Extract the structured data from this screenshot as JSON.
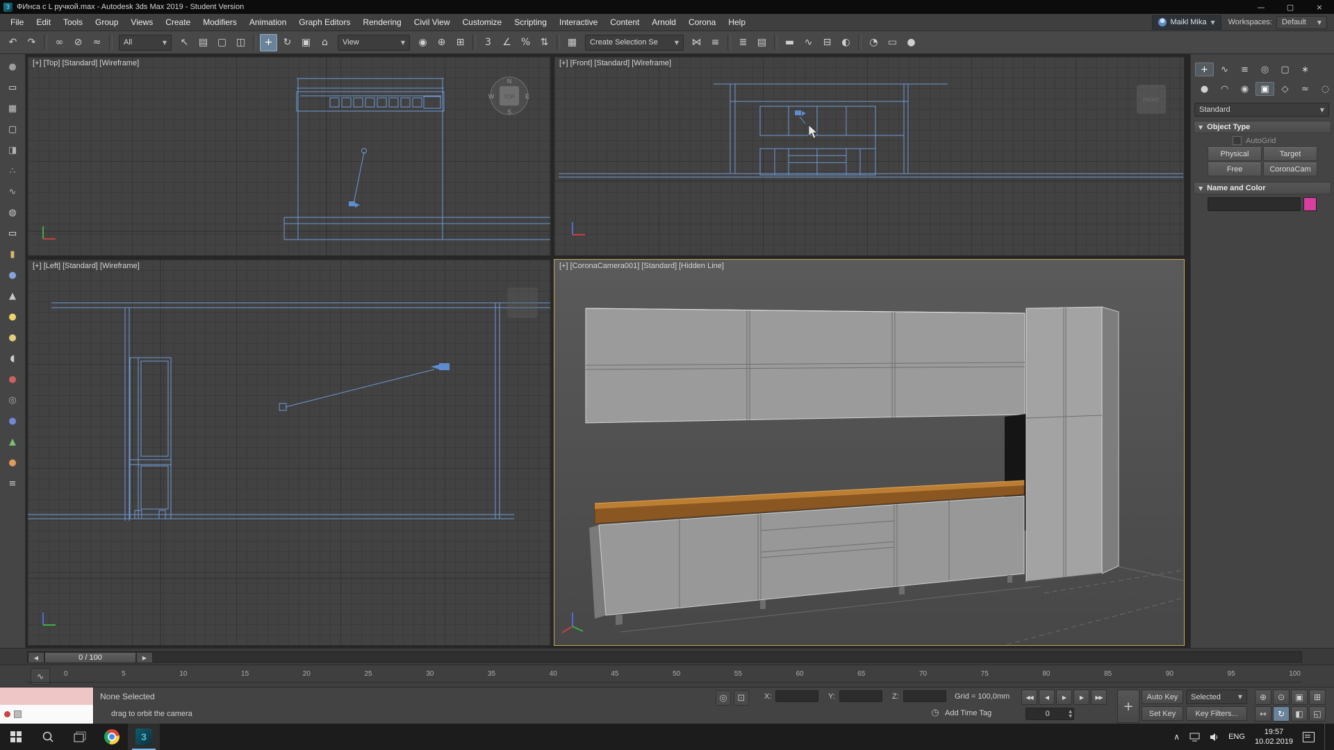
{
  "window": {
    "title": "ФИнса с L ручкой.max - Autodesk 3ds Max 2019 - Student Version",
    "controls": [
      {
        "name": "minimize-button",
        "glyph": "—"
      },
      {
        "name": "maximize-button",
        "glyph": "▢"
      },
      {
        "name": "close-button",
        "glyph": "×"
      }
    ]
  },
  "menu": {
    "items": [
      "File",
      "Edit",
      "Tools",
      "Group",
      "Views",
      "Create",
      "Modifiers",
      "Animation",
      "Graph Editors",
      "Rendering",
      "Civil View",
      "Customize",
      "Scripting",
      "Interactive",
      "Content",
      "Arnold",
      "Corona",
      "Help"
    ],
    "user": "Maikl Mika",
    "workspaces_label": "Workspaces:",
    "workspace": "Default"
  },
  "toolbar": {
    "filter_value": "All",
    "coord_value": "View",
    "selection_set_value": "Create Selection Se",
    "icons_a": [
      {
        "name": "undo-icon",
        "glyph": "↶"
      },
      {
        "name": "redo-icon",
        "glyph": "↷"
      },
      {
        "name": "toolbar-separator",
        "type": "sep"
      },
      {
        "name": "select-and-link-icon",
        "glyph": "∞"
      },
      {
        "name": "unlink-selection-icon",
        "glyph": "⊘"
      },
      {
        "name": "bind-to-space-warp-icon",
        "glyph": "≈"
      },
      {
        "name": "toolbar-separator",
        "type": "sep"
      }
    ],
    "icons_b": [
      {
        "name": "select-object-icon",
        "glyph": "↖"
      },
      {
        "name": "select-by-name-icon",
        "glyph": "▤"
      },
      {
        "name": "rectangular-selection-region-icon",
        "glyph": "▢"
      },
      {
        "name": "window-crossing-icon",
        "glyph": "◫"
      },
      {
        "name": "toolbar-separator",
        "type": "sep"
      },
      {
        "name": "select-and-move-icon",
        "glyph": "+",
        "active": true
      },
      {
        "name": "select-and-rotate-icon",
        "glyph": "↻"
      },
      {
        "name": "select-and-scale-icon",
        "glyph": "▣"
      },
      {
        "name": "select-and-place-icon",
        "glyph": "⌂"
      }
    ],
    "icons_c": [
      {
        "name": "use-pivot-point-center-icon",
        "glyph": "◉"
      },
      {
        "name": "select-and-manipulate-icon",
        "glyph": "⊕"
      },
      {
        "name": "keyboard-shortcut-override-icon",
        "glyph": "⊞"
      },
      {
        "name": "toolbar-separator",
        "type": "sep"
      },
      {
        "name": "snaps-toggle-3d-icon",
        "glyph": "3"
      },
      {
        "name": "angle-snap-toggle-icon",
        "glyph": "∠"
      },
      {
        "name": "percent-snap-toggle-icon",
        "glyph": "%"
      },
      {
        "name": "spinner-snap-toggle-icon",
        "glyph": "⇅"
      },
      {
        "name": "toolbar-separator",
        "type": "sep"
      },
      {
        "name": "edit-named-selection-sets-icon",
        "glyph": "▦"
      }
    ],
    "icons_d": [
      {
        "name": "mirror-icon",
        "glyph": "⋈"
      },
      {
        "name": "align-icon",
        "glyph": "≡"
      },
      {
        "name": "toolbar-separator",
        "type": "sep"
      },
      {
        "name": "toggle-scene-explorer-icon",
        "glyph": "≣"
      },
      {
        "name": "toggle-layer-explorer-icon",
        "glyph": "▤"
      },
      {
        "name": "toolbar-separator",
        "type": "sep"
      },
      {
        "name": "toggle-ribbon-icon",
        "glyph": "▬"
      },
      {
        "name": "curve-editor-icon",
        "glyph": "∿"
      },
      {
        "name": "schematic-view-icon",
        "glyph": "⊟"
      },
      {
        "name": "material-editor-icon",
        "glyph": "◐"
      },
      {
        "name": "toolbar-separator",
        "type": "sep"
      },
      {
        "name": "render-setup-icon",
        "glyph": "◔"
      },
      {
        "name": "rendered-frame-window-icon",
        "glyph": "▭"
      },
      {
        "name": "render-production-icon",
        "glyph": "●"
      }
    ]
  },
  "left_toolbar": {
    "items": [
      {
        "name": "sphere-gray-icon",
        "glyph": "●",
        "color": "#9c9c9c"
      },
      {
        "name": "plane-icon",
        "glyph": "▭",
        "color": "#e2e2e2"
      },
      {
        "name": "grid-icon",
        "glyph": "▦",
        "color": "#c4c4c4"
      },
      {
        "name": "box-icon",
        "glyph": "▢",
        "color": "#d6d6d6"
      },
      {
        "name": "panel-icon",
        "glyph": "◨",
        "color": "#b4b4b4"
      },
      {
        "name": "spray-icon",
        "glyph": "∴",
        "color": "#c0a8a8"
      },
      {
        "name": "wave-icon",
        "glyph": "∿",
        "color": "#b0b0c0"
      },
      {
        "name": "donut-icon",
        "glyph": "◍",
        "color": "#cccccc"
      },
      {
        "name": "plane-white-icon",
        "glyph": "▭",
        "color": "#f2f2f2"
      },
      {
        "name": "cylinder-icon",
        "glyph": "▮",
        "color": "#d6ba6e"
      },
      {
        "name": "sphere-blue-icon",
        "glyph": "●",
        "color": "#88a4dc"
      },
      {
        "name": "cone-icon",
        "glyph": "▲",
        "color": "#c9c9c9"
      },
      {
        "name": "sun-icon",
        "glyph": "●",
        "color": "#ecd36a"
      },
      {
        "name": "sphere-yellow-icon",
        "glyph": "●",
        "color": "#e3cd7c"
      },
      {
        "name": "teapot-icon",
        "glyph": "◖",
        "color": "#cfcfcf"
      },
      {
        "name": "sphere-red-icon",
        "glyph": "●",
        "color": "#d06060"
      },
      {
        "name": "wheel-icon",
        "glyph": "◎",
        "color": "#b0b0b0"
      },
      {
        "name": "sphere-blue2-icon",
        "glyph": "●",
        "color": "#6f88d6"
      },
      {
        "name": "cone-green-icon",
        "glyph": "▲",
        "color": "#7fbf6f"
      },
      {
        "name": "sphere-orange-icon",
        "glyph": "●",
        "color": "#e09a5a"
      },
      {
        "name": "menu-lines-icon",
        "glyph": "≡",
        "color": "#c8c8c8"
      }
    ]
  },
  "viewports": {
    "top_label": "[+] [Top] [Standard] [Wireframe]",
    "front_label": "[+] [Front] [Standard] [Wireframe]",
    "left_label": "[+] [Left] [Standard] [Wireframe]",
    "camera_label": "[+] [CoronaCamera001] [Standard] [Hidden Line]",
    "viewcube_top": "TOP",
    "viewcube_front": "FRONT"
  },
  "command_panel": {
    "tabs": [
      {
        "name": "create-tab-icon",
        "glyph": "+",
        "active": true
      },
      {
        "name": "modify-tab-icon",
        "glyph": "∿"
      },
      {
        "name": "hierarchy-tab-icon",
        "glyph": "≡"
      },
      {
        "name": "motion-tab-icon",
        "glyph": "◎"
      },
      {
        "name": "display-tab-icon",
        "glyph": "▢"
      },
      {
        "name": "utilities-tab-icon",
        "glyph": "∗"
      }
    ],
    "categories": [
      {
        "name": "geometry-category-icon",
        "glyph": "●"
      },
      {
        "name": "shapes-category-icon",
        "glyph": "◠"
      },
      {
        "name": "lights-category-icon",
        "glyph": "◉"
      },
      {
        "name": "cameras-category-icon",
        "glyph": "▣",
        "active": true
      },
      {
        "name": "helpers-category-icon",
        "glyph": "◇"
      },
      {
        "name": "space-warps-category-icon",
        "glyph": "≈"
      },
      {
        "name": "systems-category-icon",
        "glyph": "◌"
      }
    ],
    "object_dropdown": "Standard",
    "rollout_object_type": "Object Type",
    "autogrid": "AutoGrid",
    "buttons": [
      "Physical",
      "Target",
      "Free",
      "CoronaCam"
    ],
    "rollout_name_color": "Name and Color",
    "color_swatch": "#d93da0"
  },
  "timeline": {
    "slider": "0 / 100",
    "left_arrow": "◀",
    "right_arrow": "▶",
    "ticks": [
      "0",
      "5",
      "10",
      "15",
      "20",
      "25",
      "30",
      "35",
      "40",
      "45",
      "50",
      "55",
      "60",
      "65",
      "70",
      "75",
      "80",
      "85",
      "90",
      "95",
      "100"
    ]
  },
  "status": {
    "selection": "None Selected",
    "prompt": "drag to orbit the camera",
    "isolate_glyph": "◎",
    "lock_glyph": "⊡",
    "x": "X:",
    "y": "Y:",
    "z": "Z:",
    "grid": "Grid = 100,0mm",
    "add_time_tag": "Add Time Tag",
    "clock_glyph": "◷",
    "auto_key": "Auto Key",
    "set_key": "Set Key",
    "selected_filter": "Selected",
    "key_filters": "Key Filters...",
    "frame_spinner": "0",
    "bigkey_glyph": "+",
    "playback": [
      {
        "name": "go-to-start-button",
        "glyph": "◀◀"
      },
      {
        "name": "previous-frame-button",
        "glyph": "◀"
      },
      {
        "name": "play-button",
        "glyph": "▶"
      },
      {
        "name": "next-frame-button",
        "glyph": "▶"
      },
      {
        "name": "go-to-end-button",
        "glyph": "▶▶"
      }
    ],
    "nav": [
      {
        "name": "zoom-icon",
        "glyph": "⊕"
      },
      {
        "name": "zoom-all-icon",
        "glyph": "⊙"
      },
      {
        "name": "zoom-extents-icon",
        "glyph": "▣"
      },
      {
        "name": "zoom-extents-all-icon",
        "glyph": "⊞"
      },
      {
        "name": "pan-view-icon",
        "glyph": "↔"
      },
      {
        "name": "orbit-icon",
        "glyph": "↻",
        "active": true
      },
      {
        "name": "field-of-view-icon",
        "glyph": "◧"
      },
      {
        "name": "maximize-viewport-toggle-icon",
        "glyph": "◱"
      }
    ]
  },
  "taskbar": {
    "lang": "ENG",
    "time": "19:57",
    "date": "10.02.2019",
    "tray_expand": "∧"
  },
  "colors": {
    "active_viewport_border": "#c9a557",
    "wireframe": "#6e9ad6",
    "countertop": "#8a5722",
    "taskbar_active_underline": "#76b9ed"
  }
}
